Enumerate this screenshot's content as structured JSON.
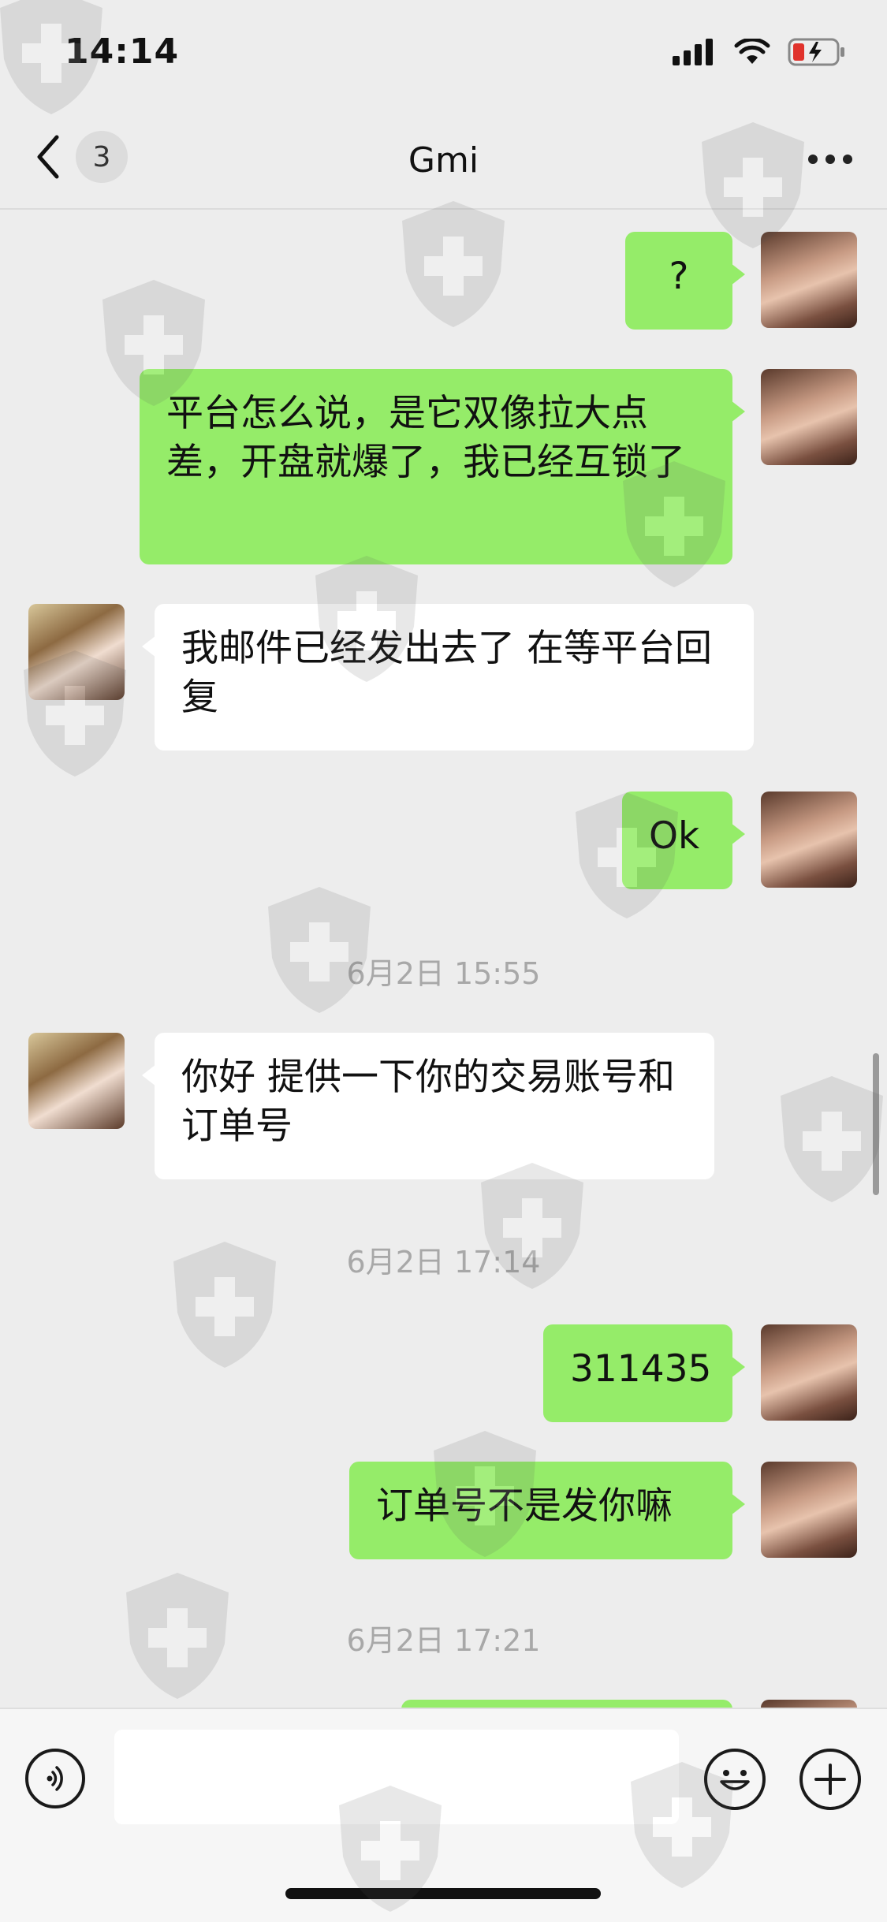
{
  "status_bar": {
    "time": "14:14",
    "signal_icon": "cellular-signal-icon",
    "wifi_icon": "wifi-icon",
    "battery_icon": "battery-low-charging-icon",
    "battery_color": "#e0322c"
  },
  "header": {
    "back_icon": "chevron-left-icon",
    "unread_count": "3",
    "title": "Gmi",
    "more_icon": "more-dots-icon"
  },
  "colors": {
    "sent_bubble": "#95ec69",
    "received_bubble": "#ffffff",
    "background": "#ededed",
    "timestamp": "#a8a8a8"
  },
  "messages": [
    {
      "side": "right",
      "text": "?"
    },
    {
      "side": "right",
      "text": "平台怎么说，是它双像拉大点差，开盘就爆了，我已经互锁了"
    },
    {
      "side": "left",
      "text": "我邮件已经发出去了 在等平台回复"
    },
    {
      "side": "right",
      "text": "Ok"
    },
    {
      "type": "timestamp",
      "text": "6月2日 15:55"
    },
    {
      "side": "left",
      "text": "你好 提供一下你的交易账号和订单号"
    },
    {
      "type": "timestamp",
      "text": "6月2日 17:14"
    },
    {
      "side": "right",
      "text": "311435"
    },
    {
      "side": "right",
      "text": "订单号不是发你嘛"
    },
    {
      "type": "timestamp",
      "text": "6月2日 17:21"
    }
  ],
  "input_bar": {
    "voice_icon": "voice-input-icon",
    "message_value": "",
    "emoji_icon": "emoji-smile-icon",
    "plus_icon": "plus-circle-icon"
  },
  "watermark_icon": "shield-cross-icon"
}
